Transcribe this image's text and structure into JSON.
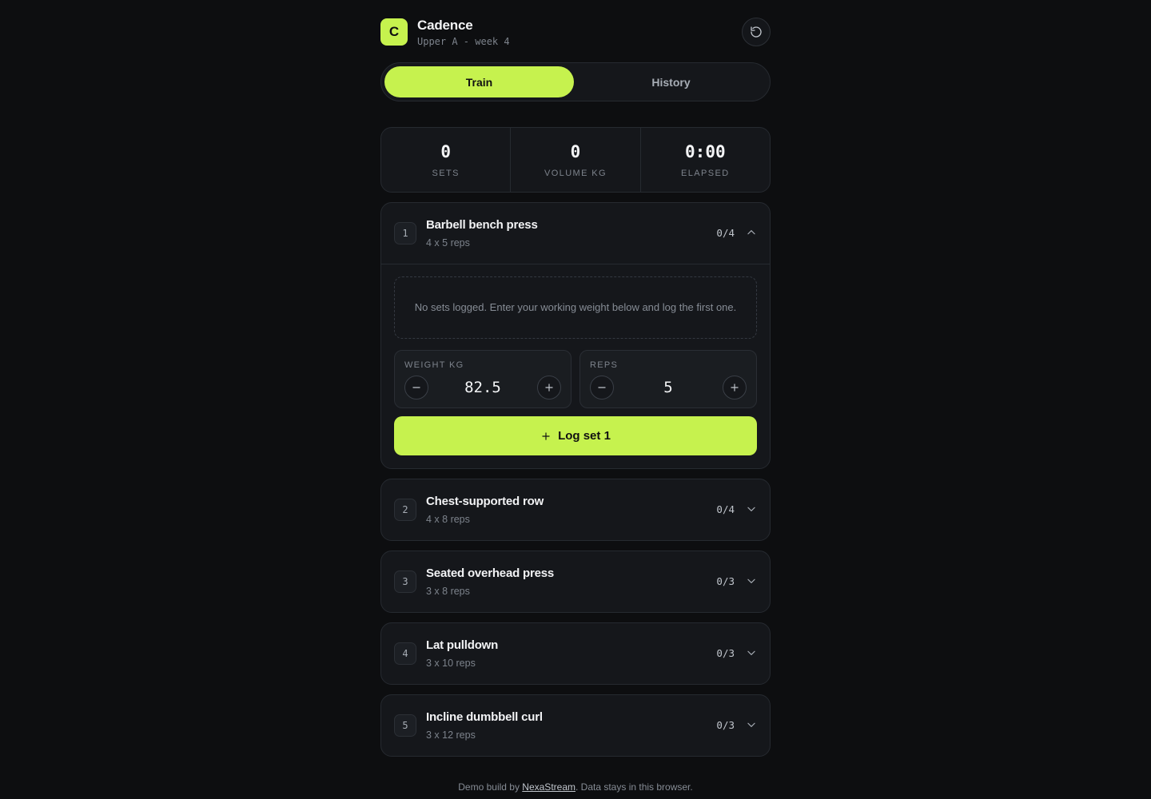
{
  "header": {
    "logo_letter": "C",
    "title": "Cadence",
    "subtitle": "Upper A - week 4",
    "reset_icon": "reset-icon"
  },
  "tabs": [
    {
      "label": "Train",
      "active": true
    },
    {
      "label": "History",
      "active": false
    }
  ],
  "stats": [
    {
      "value": "0",
      "label": "SETS"
    },
    {
      "value": "0",
      "label": "VOLUME KG"
    },
    {
      "value": "0:00",
      "label": "ELAPSED"
    }
  ],
  "exercises": [
    {
      "num": "1",
      "name": "Barbell bench press",
      "scheme": "4 x 5 reps",
      "progress": "0/4",
      "expanded": true
    },
    {
      "num": "2",
      "name": "Chest-supported row",
      "scheme": "4 x 8 reps",
      "progress": "0/4",
      "expanded": false
    },
    {
      "num": "3",
      "name": "Seated overhead press",
      "scheme": "3 x 8 reps",
      "progress": "0/3",
      "expanded": false
    },
    {
      "num": "4",
      "name": "Lat pulldown",
      "scheme": "3 x 10 reps",
      "progress": "0/3",
      "expanded": false
    },
    {
      "num": "5",
      "name": "Incline dumbbell curl",
      "scheme": "3 x 12 reps",
      "progress": "0/3",
      "expanded": false
    }
  ],
  "active_exercise": {
    "empty_message": "No sets logged. Enter your working weight below and log the first one.",
    "weight_label": "WEIGHT KG",
    "weight_value": "82.5",
    "reps_label": "REPS",
    "reps_value": "5",
    "log_button_label": "Log set 1"
  },
  "footer": {
    "prefix": "Demo build by ",
    "link_text": "NexaStream",
    "suffix": ". Data stays in this browser."
  },
  "colors": {
    "accent": "#c6f24e",
    "background": "#0d0e10",
    "surface": "#15171b"
  }
}
